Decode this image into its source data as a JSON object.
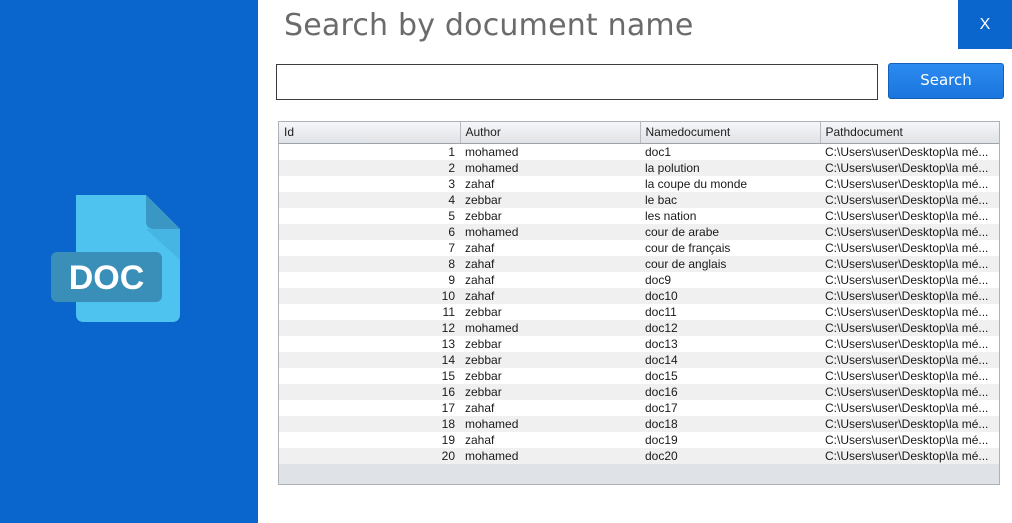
{
  "window": {
    "title": "Search by document name",
    "close_label": "X"
  },
  "sidebar": {
    "icon_text": "DOC"
  },
  "search": {
    "value": "",
    "placeholder": "",
    "button_label": "Search"
  },
  "table": {
    "columns": [
      "Id",
      "Author",
      "Namedocument",
      "Pathdocument"
    ],
    "rows": [
      [
        "1",
        "mohamed",
        "doc1",
        "C:\\Users\\user\\Desktop\\la mé..."
      ],
      [
        "2",
        "mohamed",
        "la polution",
        "C:\\Users\\user\\Desktop\\la mé..."
      ],
      [
        "3",
        "zahaf",
        "la coupe du  monde",
        "C:\\Users\\user\\Desktop\\la mé..."
      ],
      [
        "4",
        "zebbar",
        "le bac",
        "C:\\Users\\user\\Desktop\\la mé..."
      ],
      [
        "5",
        "zebbar",
        "les nation",
        "C:\\Users\\user\\Desktop\\la mé..."
      ],
      [
        "6",
        "mohamed",
        "cour de arabe",
        "C:\\Users\\user\\Desktop\\la mé..."
      ],
      [
        "7",
        "zahaf",
        "cour de français",
        "C:\\Users\\user\\Desktop\\la mé..."
      ],
      [
        "8",
        "zahaf",
        "cour de anglais",
        "C:\\Users\\user\\Desktop\\la mé..."
      ],
      [
        "9",
        "zahaf",
        "doc9",
        "C:\\Users\\user\\Desktop\\la mé..."
      ],
      [
        "10",
        "zahaf",
        "doc10",
        "C:\\Users\\user\\Desktop\\la mé..."
      ],
      [
        "11",
        "zebbar",
        "doc11",
        "C:\\Users\\user\\Desktop\\la mé..."
      ],
      [
        "12",
        "mohamed",
        "doc12",
        "C:\\Users\\user\\Desktop\\la mé..."
      ],
      [
        "13",
        "zebbar",
        "doc13",
        "C:\\Users\\user\\Desktop\\la mé..."
      ],
      [
        "14",
        "zebbar",
        "doc14",
        "C:\\Users\\user\\Desktop\\la mé..."
      ],
      [
        "15",
        "zebbar",
        "doc15",
        "C:\\Users\\user\\Desktop\\la mé..."
      ],
      [
        "16",
        "zebbar",
        "doc16",
        "C:\\Users\\user\\Desktop\\la mé..."
      ],
      [
        "17",
        "zahaf",
        "doc17",
        "C:\\Users\\user\\Desktop\\la mé..."
      ],
      [
        "18",
        "mohamed",
        "doc18",
        "C:\\Users\\user\\Desktop\\la mé..."
      ],
      [
        "19",
        "zahaf",
        "doc19",
        "C:\\Users\\user\\Desktop\\la mé..."
      ],
      [
        "20",
        "mohamed",
        "doc20",
        "C:\\Users\\user\\Desktop\\la mé..."
      ]
    ]
  },
  "colors": {
    "sidebar": "#0a66cc",
    "accent": "#1a7ae6",
    "title_text": "#6b6b6b",
    "icon_body": "#4fc3f0",
    "icon_label": "#3a8fb8"
  }
}
